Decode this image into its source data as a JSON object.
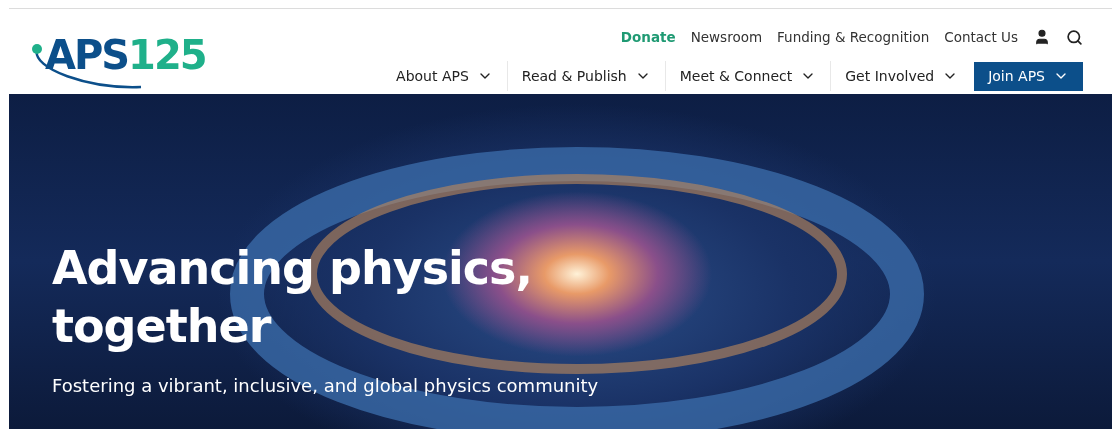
{
  "logo": {
    "name": "APS",
    "number": "125"
  },
  "utility_nav": [
    {
      "label": "Donate",
      "featured": true
    },
    {
      "label": "Newsroom",
      "featured": false
    },
    {
      "label": "Funding & Recognition",
      "featured": false
    },
    {
      "label": "Contact Us",
      "featured": false
    }
  ],
  "main_nav": [
    {
      "label": "About APS"
    },
    {
      "label": "Read & Publish"
    },
    {
      "label": "Meet & Connect"
    },
    {
      "label": "Get Involved"
    }
  ],
  "join_button": {
    "label": "Join APS"
  },
  "hero": {
    "title": "Advancing physics, together",
    "subtitle": "Fostering a vibrant, inclusive, and global physics community"
  }
}
